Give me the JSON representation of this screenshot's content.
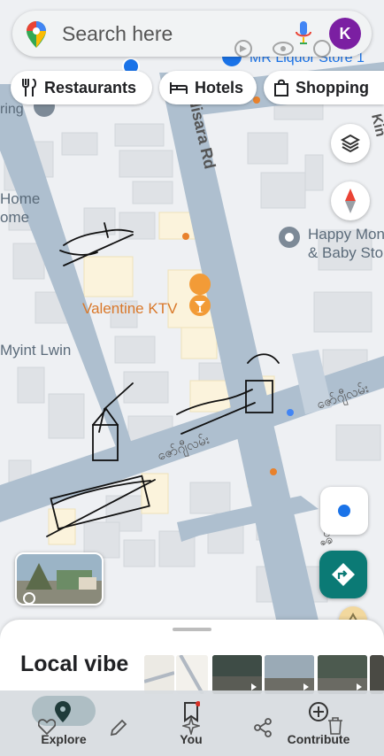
{
  "search": {
    "placeholder": "Search here",
    "avatar_letter": "K"
  },
  "chips": [
    {
      "label": "Restaurants",
      "icon": "fork-knife-icon"
    },
    {
      "label": "Hotels",
      "icon": "bed-icon"
    },
    {
      "label": "Shopping",
      "icon": "shopping-bag-icon"
    }
  ],
  "map": {
    "roads": {
      "nisara": "Nisara Rd",
      "kin": "Kin",
      "ring": "ring"
    },
    "places": {
      "mr_liquor": "MR Liquor Store 1",
      "happy_mom_1": "Happy Mon",
      "happy_mom_2": "& Baby Sto",
      "valentine": "Valentine KTV",
      "myint_lwin": "Myint Lwin",
      "home_1": "Home",
      "home_2": "ome"
    },
    "burmese_labels": {
      "street_a": "ဇော်ဂျီလမ်း",
      "street_b": "ဇော်ဂျီလမ်း",
      "bottom": "ဝိဇ္ဇ"
    }
  },
  "sheet": {
    "title": "Local vibe"
  },
  "nav": {
    "explore": "Explore",
    "you": "You",
    "contribute": "Contribute"
  },
  "colors": {
    "accent": "#0b7a75",
    "road": "#aebfcf",
    "building": "#dfe2e6",
    "highlight_building": "#fbf3dc",
    "poi_orange": "#e8812c"
  }
}
